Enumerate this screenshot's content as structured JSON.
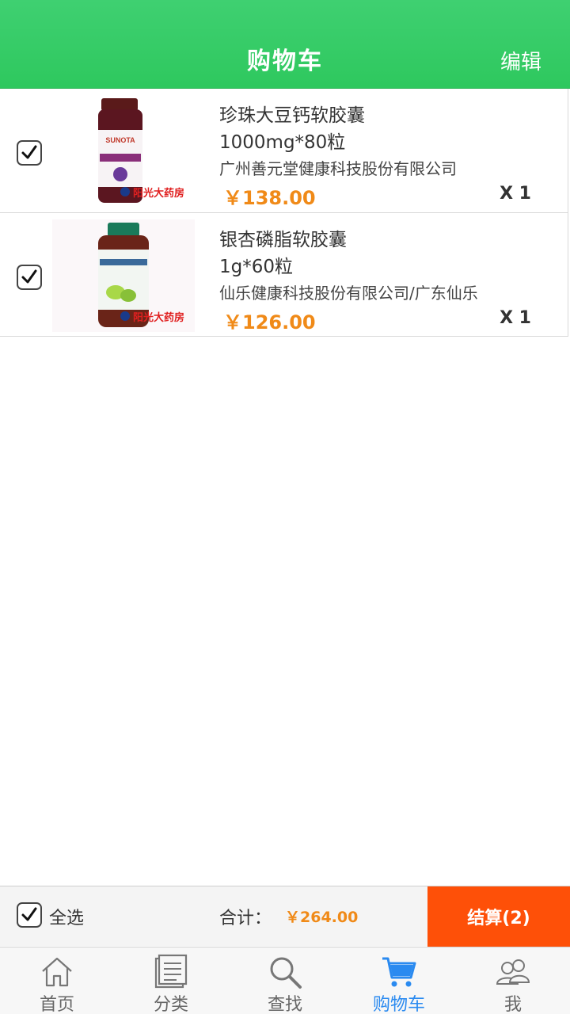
{
  "header": {
    "title": "购物车",
    "edit_label": "编辑"
  },
  "cart": {
    "items": [
      {
        "name": "珍珠大豆钙软胶囊",
        "spec": "1000mg*80粒",
        "maker": "广州善元堂健康科技股份有限公司",
        "price": "￥138.00",
        "qty": "X 1",
        "checked": true,
        "image_brand": "SUNOTA",
        "image_watermark": "阳光大药房"
      },
      {
        "name": "银杏磷脂软胶囊",
        "spec": "1g*60粒",
        "maker": "仙乐健康科技股份有限公司/广东仙乐",
        "price": "￥126.00",
        "qty": "X 1",
        "checked": true,
        "image_watermark": "阳光大药房"
      }
    ]
  },
  "checkout": {
    "select_all_label": "全选",
    "select_all_checked": true,
    "total_label": "合计：",
    "total_value": "￥264.00",
    "button_label": "结算(2)"
  },
  "tabs": [
    {
      "label": "首页",
      "icon": "home-icon",
      "active": false
    },
    {
      "label": "分类",
      "icon": "list-icon",
      "active": false
    },
    {
      "label": "查找",
      "icon": "search-icon",
      "active": false
    },
    {
      "label": "购物车",
      "icon": "cart-icon",
      "active": true
    },
    {
      "label": "我",
      "icon": "user-icon",
      "active": false
    }
  ],
  "colors": {
    "header_green": "#33cc63",
    "price_orange": "#f08a18",
    "checkout_orange": "#fe5008",
    "tab_active_blue": "#2a8af0"
  }
}
